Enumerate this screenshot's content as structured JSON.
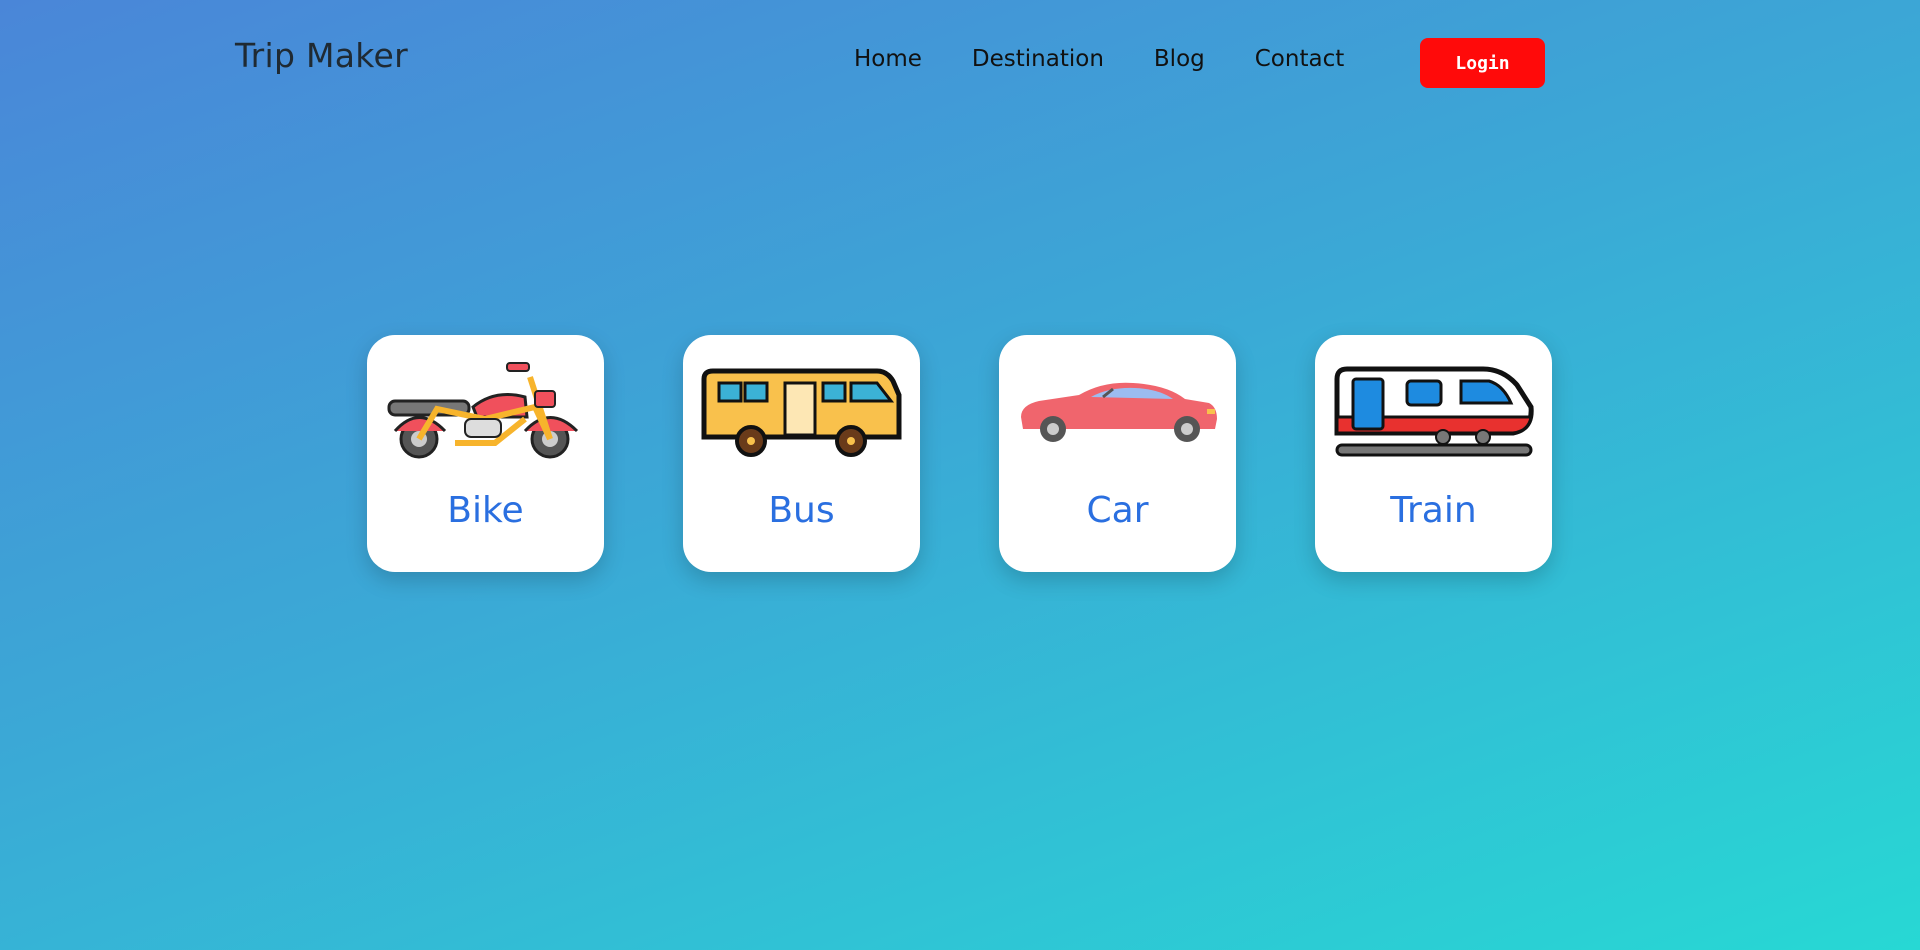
{
  "header": {
    "brand": "Trip Maker",
    "nav": [
      "Home",
      "Destination",
      "Blog",
      "Contact"
    ],
    "login_label": "Login"
  },
  "cards": [
    {
      "label": "Bike",
      "icon": "motorcycle-icon"
    },
    {
      "label": "Bus",
      "icon": "bus-icon"
    },
    {
      "label": "Car",
      "icon": "car-icon"
    },
    {
      "label": "Train",
      "icon": "train-icon"
    }
  ],
  "colors": {
    "gradient_start": "#4a86d8",
    "gradient_end": "#27d8d4",
    "login_bg": "#ff0a0a",
    "card_label": "#2a6fe0"
  }
}
